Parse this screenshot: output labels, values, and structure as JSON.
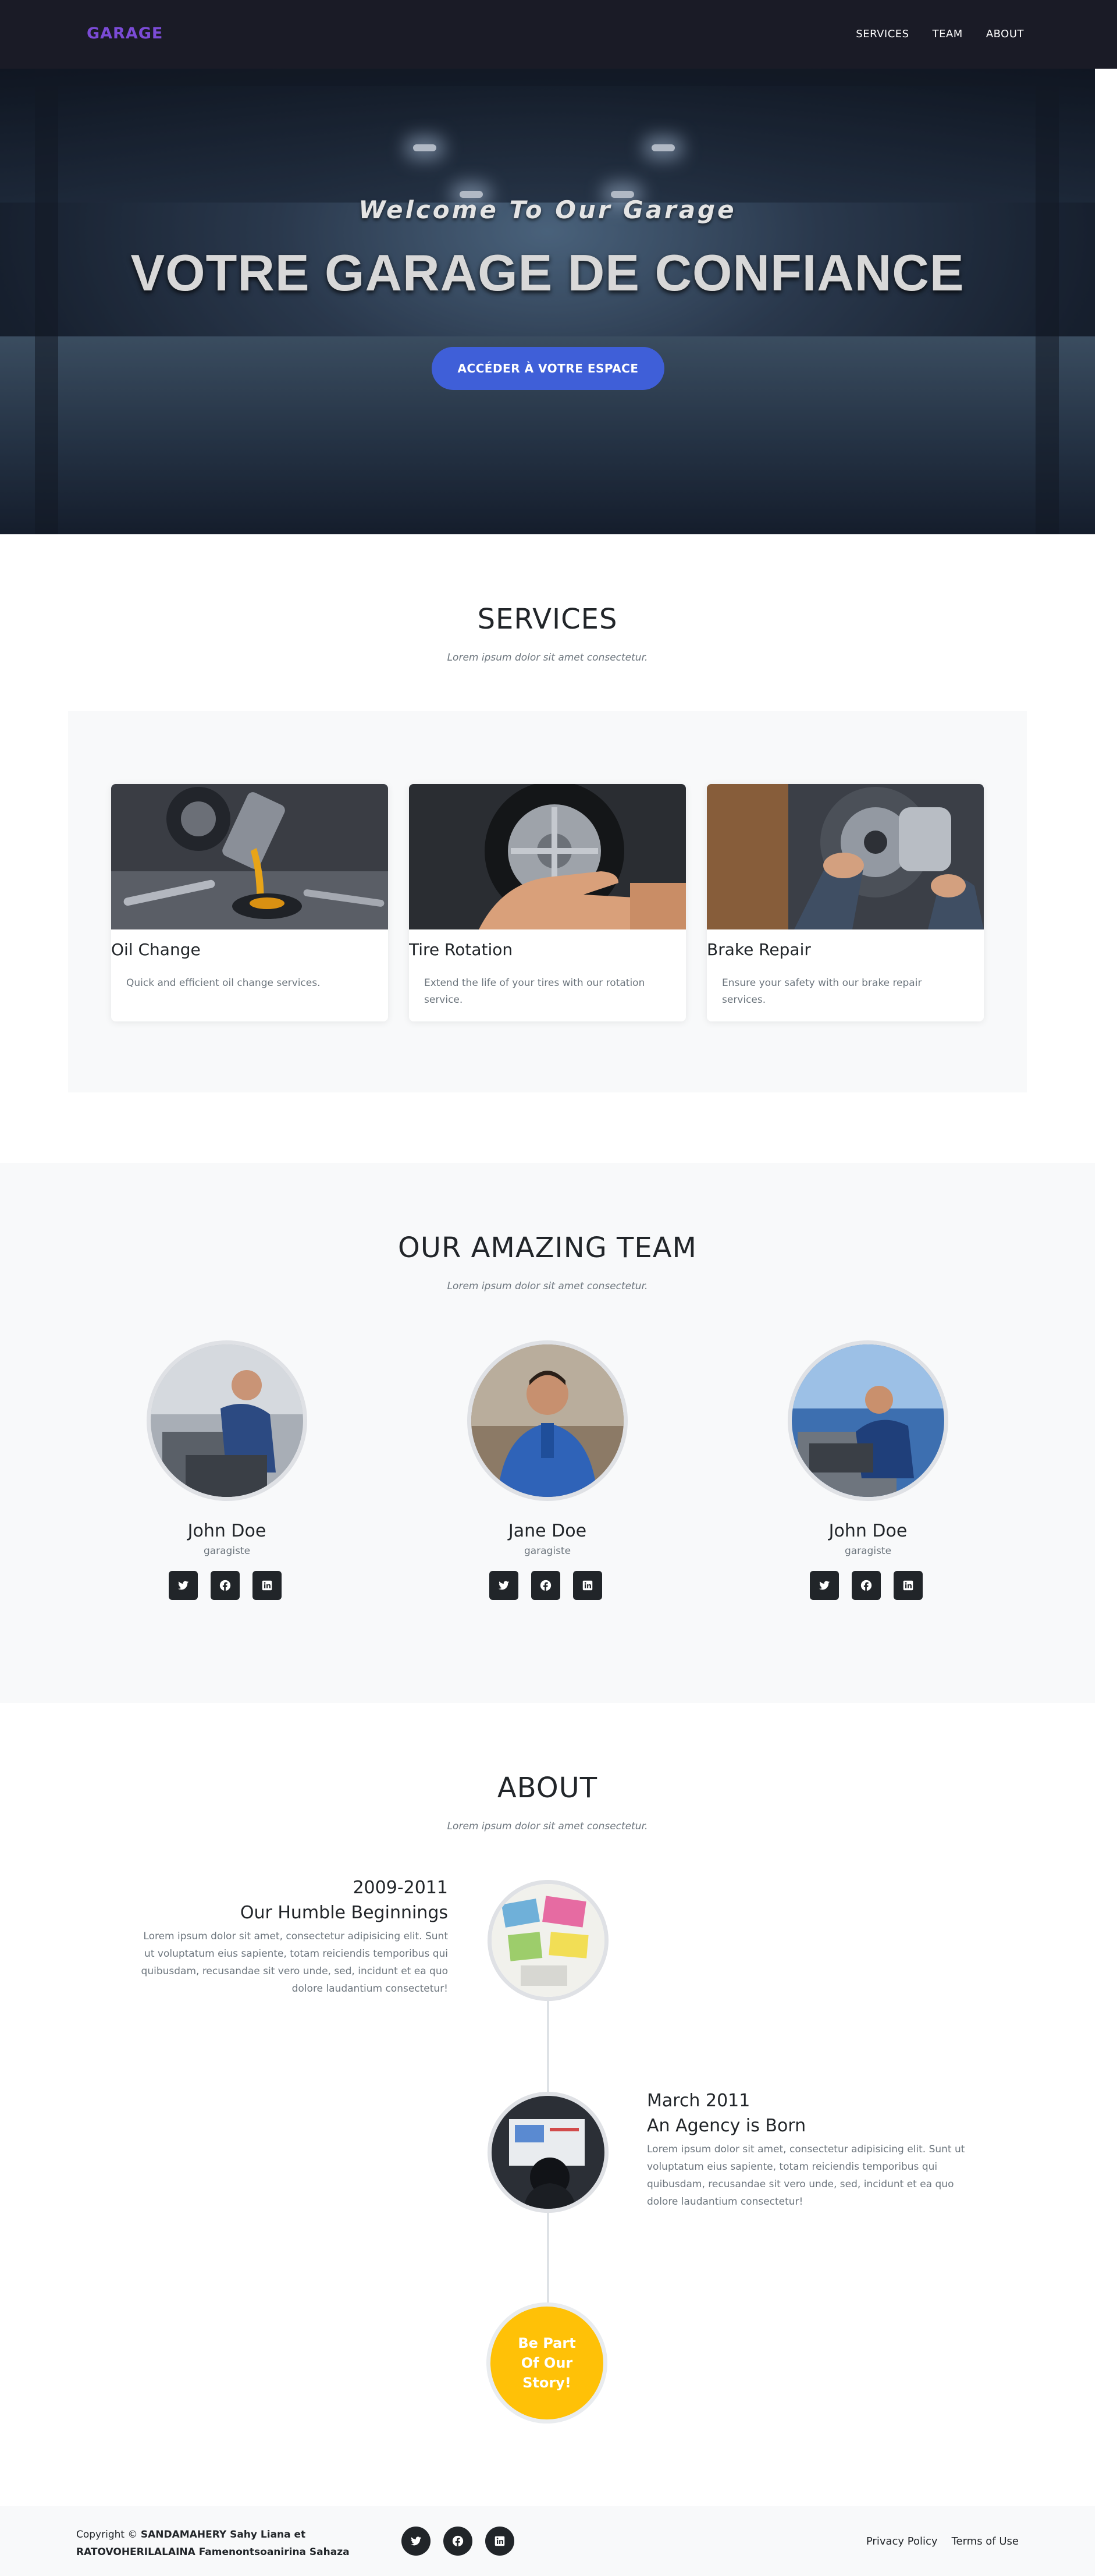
{
  "navbar": {
    "brand": "GARAGE",
    "links": [
      "SERVICES",
      "TEAM",
      "ABOUT"
    ]
  },
  "hero": {
    "subtitle": "Welcome To Our Garage",
    "title": "VOTRE GARAGE DE CONFIANCE",
    "cta_label": "ACCÉDER À VOTRE ESPACE"
  },
  "services": {
    "title": "SERVICES",
    "subtitle": "Lorem ipsum dolor sit amet consectetur.",
    "items": [
      {
        "name": "Oil Change",
        "description": "Quick and efficient oil change services."
      },
      {
        "name": "Tire Rotation",
        "description": "Extend the life of your tires with our rotation service."
      },
      {
        "name": "Brake Repair",
        "description": "Ensure your safety with our brake repair services."
      }
    ]
  },
  "team": {
    "title": "OUR AMAZING TEAM",
    "subtitle": "Lorem ipsum dolor sit amet consectetur.",
    "members": [
      {
        "name": "John Doe",
        "role": "garagiste"
      },
      {
        "name": "Jane Doe",
        "role": "garagiste"
      },
      {
        "name": "John Doe",
        "role": "garagiste"
      }
    ],
    "social_icons": [
      "twitter-icon",
      "facebook-icon",
      "linkedin-icon"
    ]
  },
  "about": {
    "title": "ABOUT",
    "subtitle": "Lorem ipsum dolor sit amet consectetur.",
    "events": [
      {
        "date": "2009-2011",
        "heading": "Our Humble Beginnings",
        "body": "Lorem ipsum dolor sit amet, consectetur adipisicing elit. Sunt ut voluptatum eius sapiente, totam reiciendis temporibus qui quibusdam, recusandae sit vero unde, sed, incidunt et ea quo dolore laudantium consectetur!"
      },
      {
        "date": "March 2011",
        "heading": "An Agency is Born",
        "body": "Lorem ipsum dolor sit amet, consectetur adipisicing elit. Sunt ut voluptatum eius sapiente, totam reiciendis temporibus qui quibusdam, recusandae sit vero unde, sed, incidunt et ea quo dolore laudantium consectetur!"
      }
    ],
    "story": [
      "Be Part",
      "Of Our",
      "Story!"
    ]
  },
  "footer": {
    "copyright_prefix": "Copyright ©",
    "authors_line1": "SANDAMAHERY Sahy Liana et",
    "authors_line2": "RATOVOHERILALAINA Famenontsoanirina Sahaza",
    "links": [
      "Privacy Policy",
      "Terms of Use"
    ]
  },
  "colors": {
    "brand": "#7b4bd6",
    "navbar_bg": "#1a1b26",
    "cta_blue": "#3f5fd8",
    "story_yellow": "#ffc107",
    "section_bg": "#f8f9fa"
  }
}
